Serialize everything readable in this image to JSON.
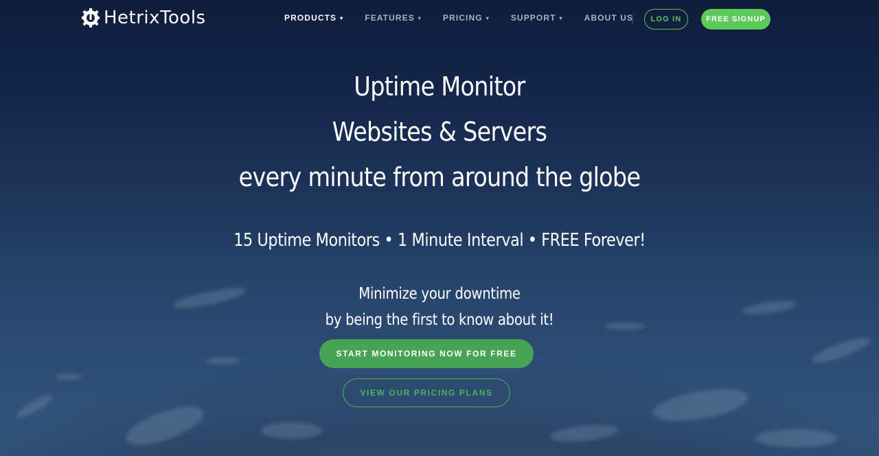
{
  "brand": {
    "name": "HetrixTools",
    "logo_icon": "gear-wrench-icon"
  },
  "nav": {
    "items": [
      {
        "label": "PRODUCTS",
        "has_dropdown": true,
        "active": true
      },
      {
        "label": "FEATURES",
        "has_dropdown": true,
        "active": false
      },
      {
        "label": "PRICING",
        "has_dropdown": true,
        "active": false
      },
      {
        "label": "SUPPORT",
        "has_dropdown": true,
        "active": false
      },
      {
        "label": "ABOUT US",
        "has_dropdown": false,
        "active": false
      }
    ],
    "caret": "▾",
    "login_label": "LOG IN",
    "signup_label": "FREE SIGNUP"
  },
  "hero": {
    "title_lines": [
      "Uptime Monitor",
      "Websites & Servers",
      "every minute from around the globe"
    ],
    "tagline": "15 Uptime Monitors • 1 Minute Interval • FREE Forever!",
    "sub_lines": [
      "Minimize your downtime",
      "by being the first to know about it!"
    ],
    "cta_primary": "START MONITORING NOW FOR FREE",
    "cta_secondary": "VIEW OUR PRICING PLANS"
  },
  "colors": {
    "accent_green": "#5dc95a",
    "cta_green": "#48a455",
    "navy": "#0f1d3b"
  }
}
